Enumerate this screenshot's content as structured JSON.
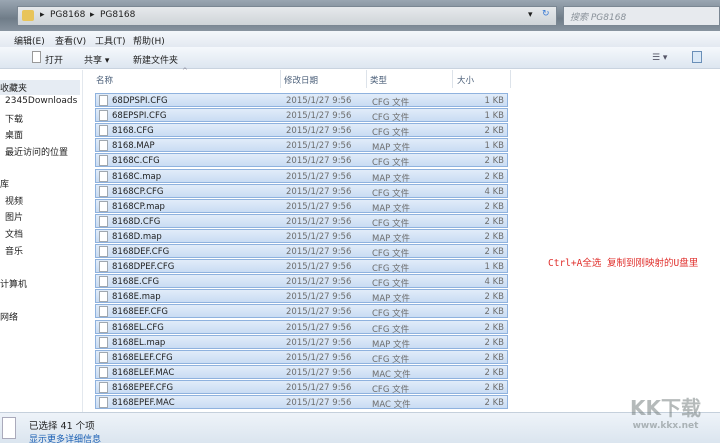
{
  "address": {
    "path": [
      "PG8168",
      "PG8168"
    ],
    "search_placeholder": "搜索 PG8168"
  },
  "menu": [
    "编辑(E)",
    "查看(V)",
    "工具(T)",
    "帮助(H)"
  ],
  "toolbar": {
    "open": "打开",
    "share": "共享 ▾",
    "new_folder": "新建文件夹"
  },
  "sidebar": {
    "favorites": "收藏夹",
    "items": [
      "2345Downloads",
      "下载",
      "桌面",
      "最近访问的位置"
    ],
    "libraries": "库",
    "lib_items": [
      "视频",
      "图片",
      "文档",
      "音乐"
    ],
    "computer": "计算机",
    "network": "网络"
  },
  "columns": {
    "name": "名称",
    "date": "修改日期",
    "type": "类型",
    "size": "大小"
  },
  "files": [
    {
      "name": "68DPSPI.CFG",
      "date": "2015/1/27 9:56",
      "type": "CFG 文件",
      "size": "1 KB"
    },
    {
      "name": "68EPSPI.CFG",
      "date": "2015/1/27 9:56",
      "type": "CFG 文件",
      "size": "1 KB"
    },
    {
      "name": "8168.CFG",
      "date": "2015/1/27 9:56",
      "type": "CFG 文件",
      "size": "2 KB"
    },
    {
      "name": "8168.MAP",
      "date": "2015/1/27 9:56",
      "type": "MAP 文件",
      "size": "1 KB"
    },
    {
      "name": "8168C.CFG",
      "date": "2015/1/27 9:56",
      "type": "CFG 文件",
      "size": "2 KB"
    },
    {
      "name": "8168C.map",
      "date": "2015/1/27 9:56",
      "type": "MAP 文件",
      "size": "2 KB"
    },
    {
      "name": "8168CP.CFG",
      "date": "2015/1/27 9:56",
      "type": "CFG 文件",
      "size": "4 KB"
    },
    {
      "name": "8168CP.map",
      "date": "2015/1/27 9:56",
      "type": "MAP 文件",
      "size": "2 KB"
    },
    {
      "name": "8168D.CFG",
      "date": "2015/1/27 9:56",
      "type": "CFG 文件",
      "size": "2 KB"
    },
    {
      "name": "8168D.map",
      "date": "2015/1/27 9:56",
      "type": "MAP 文件",
      "size": "2 KB"
    },
    {
      "name": "8168DEF.CFG",
      "date": "2015/1/27 9:56",
      "type": "CFG 文件",
      "size": "2 KB"
    },
    {
      "name": "8168DPEF.CFG",
      "date": "2015/1/27 9:56",
      "type": "CFG 文件",
      "size": "1 KB"
    },
    {
      "name": "8168E.CFG",
      "date": "2015/1/27 9:56",
      "type": "CFG 文件",
      "size": "4 KB"
    },
    {
      "name": "8168E.map",
      "date": "2015/1/27 9:56",
      "type": "MAP 文件",
      "size": "2 KB"
    },
    {
      "name": "8168EEF.CFG",
      "date": "2015/1/27 9:56",
      "type": "CFG 文件",
      "size": "2 KB"
    },
    {
      "name": "8168EL.CFG",
      "date": "2015/1/27 9:56",
      "type": "CFG 文件",
      "size": "2 KB"
    },
    {
      "name": "8168EL.map",
      "date": "2015/1/27 9:56",
      "type": "MAP 文件",
      "size": "2 KB"
    },
    {
      "name": "8168ELEF.CFG",
      "date": "2015/1/27 9:56",
      "type": "CFG 文件",
      "size": "2 KB"
    },
    {
      "name": "8168ELEF.MAC",
      "date": "2015/1/27 9:56",
      "type": "MAC 文件",
      "size": "2 KB"
    },
    {
      "name": "8168EPEF.CFG",
      "date": "2015/1/27 9:56",
      "type": "CFG 文件",
      "size": "2 KB"
    },
    {
      "name": "8168EPEF.MAC",
      "date": "2015/1/27 9:56",
      "type": "MAC 文件",
      "size": "2 KB"
    }
  ],
  "status": {
    "selected": "已选择 41 个项",
    "details_link": "显示更多详细信息"
  },
  "annotation": "Ctrl+A全选 复制到刚映射的U盘里",
  "watermark": {
    "logo": "KK下载",
    "url": "www.kkx.net"
  }
}
